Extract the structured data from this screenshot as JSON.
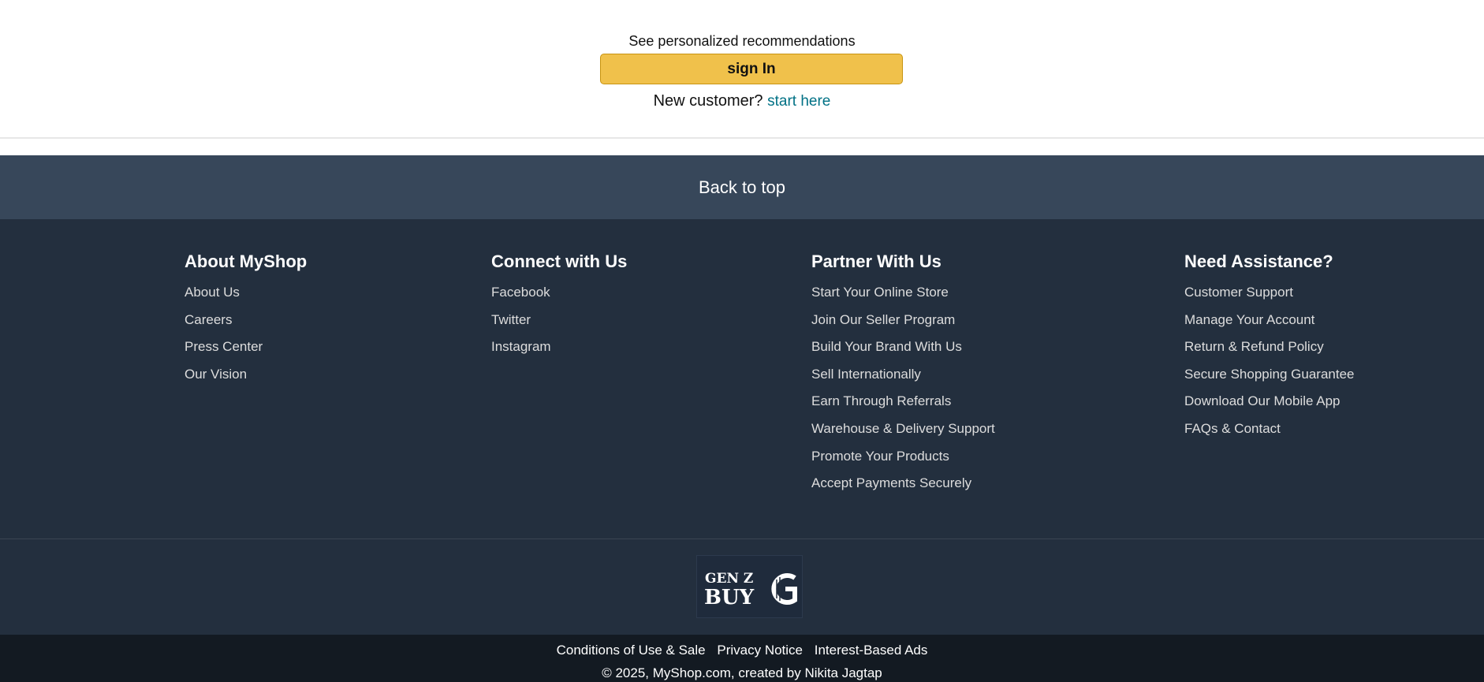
{
  "signin": {
    "recommendation_text": "See personalized recommendations",
    "button_label": "sign In",
    "new_customer_text": "New customer?",
    "start_here_link": "start here"
  },
  "back_to_top": "Back to top",
  "footer": {
    "columns": [
      {
        "heading": "About MyShop",
        "items": [
          "About Us",
          "Careers",
          "Press Center",
          "Our Vision"
        ]
      },
      {
        "heading": "Connect with Us",
        "items": [
          "Facebook",
          "Twitter",
          "Instagram"
        ]
      },
      {
        "heading": "Partner With Us",
        "items": [
          "Start Your Online Store",
          "Join Our Seller Program",
          "Build Your Brand With Us",
          "Sell Internationally",
          "Earn Through Referrals",
          "Warehouse & Delivery Support",
          "Promote Your Products",
          "Accept Payments Securely"
        ]
      },
      {
        "heading": "Need Assistance?",
        "items": [
          "Customer Support",
          "Manage Your Account",
          "Return & Refund Policy",
          "Secure Shopping Guarantee",
          "Download Our Mobile App",
          "FAQs & Contact"
        ]
      }
    ],
    "logo": {
      "line1": "GEN Z",
      "line2": "BUY"
    },
    "legal_links": [
      "Conditions of Use & Sale",
      "Privacy Notice",
      "Interest-Based Ads"
    ],
    "copyright": "© 2025, MyShop.com, created by Nikita Jagtap"
  },
  "colors": {
    "signin_button": "#f0c14b",
    "link": "#007185",
    "back_to_top_bg": "#37475a",
    "footer_bg": "#232f3e",
    "bottom_bar_bg": "#131a22"
  }
}
